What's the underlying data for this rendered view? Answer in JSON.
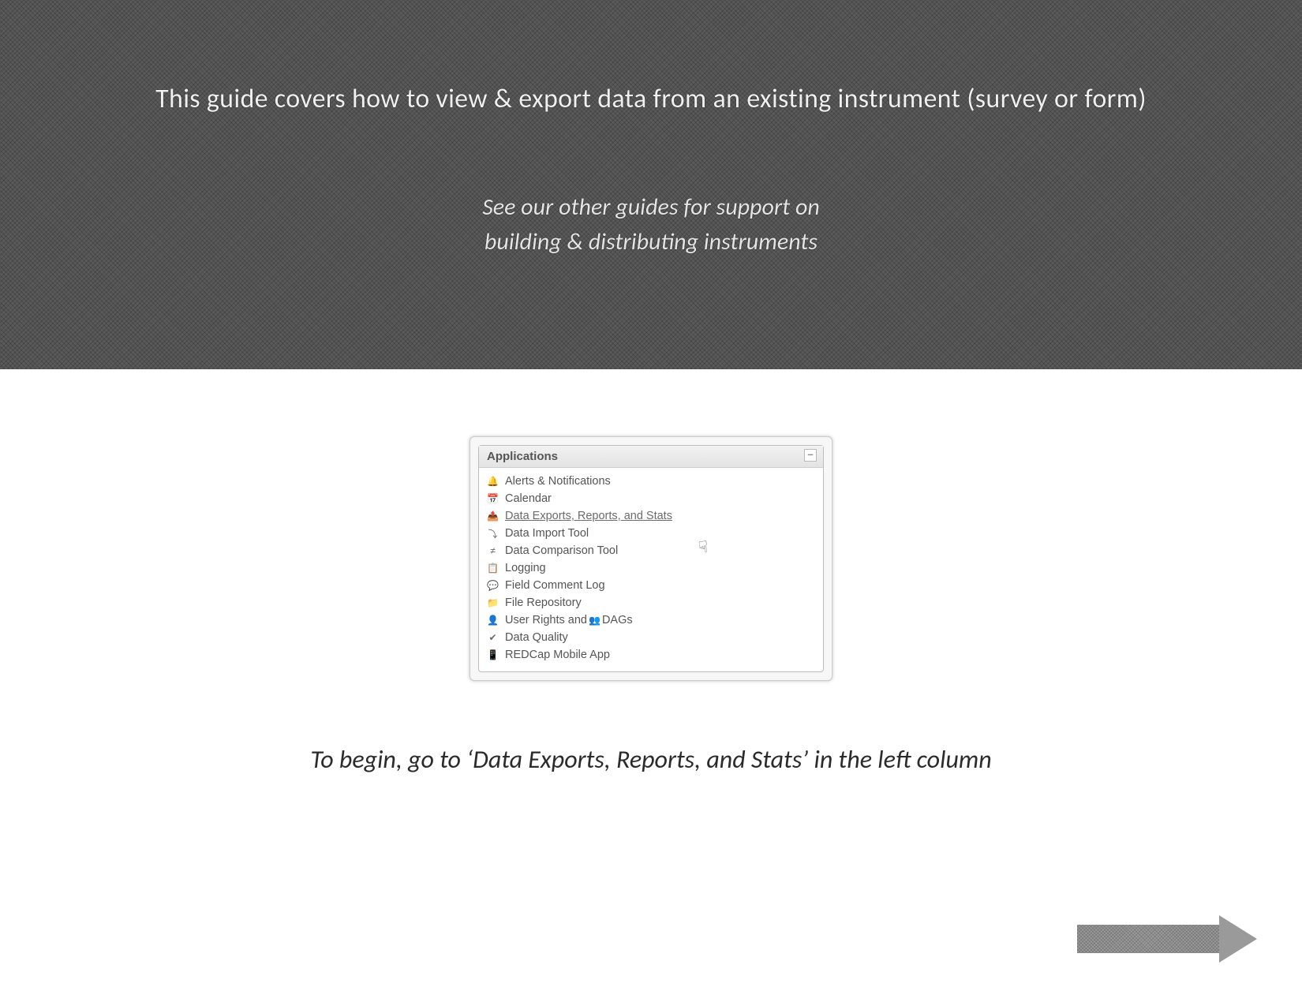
{
  "banner": {
    "title": "This guide covers how to view & export data from an existing instrument (survey or form)",
    "subtitle_line1": "See our other guides for support on",
    "subtitle_line2": "building & distributing instruments"
  },
  "apps": {
    "header": "Applications",
    "minimize_glyph": "–",
    "items": [
      {
        "icon": "bell-icon",
        "glyph": "🔔",
        "label": "Alerts & Notifications"
      },
      {
        "icon": "calendar-icon",
        "glyph": "📅",
        "label": "Calendar"
      },
      {
        "icon": "export-icon",
        "glyph": "📤",
        "label": "Data Exports, Reports, and Stats",
        "highlight": true
      },
      {
        "icon": "import-icon",
        "glyph": "⤵",
        "label": "Data Import Tool"
      },
      {
        "icon": "compare-icon",
        "glyph": "≠",
        "label": "Data Comparison Tool"
      },
      {
        "icon": "log-icon",
        "glyph": "📋",
        "label": "Logging"
      },
      {
        "icon": "comment-icon",
        "glyph": "💬",
        "label": "Field Comment Log"
      },
      {
        "icon": "folder-icon",
        "glyph": "📁",
        "label": "File Repository"
      },
      {
        "icon": "user-icon",
        "glyph": "👤",
        "label_prefix": "User Rights and ",
        "dag_glyph": "👥",
        "label_suffix": "DAGs"
      },
      {
        "icon": "quality-icon",
        "glyph": "✔",
        "label": "Data Quality"
      },
      {
        "icon": "mobile-icon",
        "glyph": "📱",
        "label": "REDCap Mobile App"
      }
    ]
  },
  "caption": "To begin, go to ‘Data Exports, Reports, and Stats’ in the left column",
  "cursor_glyph": "☟",
  "nav": {
    "next_arrow": "next-arrow"
  }
}
